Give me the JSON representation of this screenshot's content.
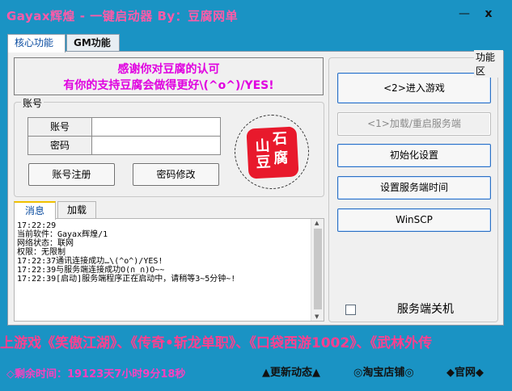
{
  "window": {
    "title": "Gayax辉煌 - 一键启动器  By：豆腐网单",
    "minimize_label": "—",
    "close_label": "x"
  },
  "top_tabs": [
    {
      "label": "核心功能"
    },
    {
      "label": "GM功能"
    }
  ],
  "banner": {
    "line1": "感谢你对豆腐的认可",
    "line2": "有你的支持豆腐会做得更好\\(^o^)/YES!"
  },
  "account": {
    "group_label": "账号",
    "username_label": "账号",
    "password_label": "密码",
    "username_value": "",
    "password_value": "",
    "register_button": "账号注册",
    "change_password_button": "密码修改",
    "seal_chars": [
      "山",
      "石",
      "豆",
      "腐"
    ]
  },
  "log_tabs": [
    {
      "label": "消息"
    },
    {
      "label": "加载"
    }
  ],
  "log": {
    "text": "17:22:29\n当前软件：Gayax辉煌/1\n网络状态：联网\n权限：无限制\n17:22:37通讯连接成功…\\(^o^)/YES!\n17:22:39与服务端连接成功O(∩_∩)O~~\n17:22:39[启动]服务端程序正在启动中，请稍等3~5分钟~!"
  },
  "functions": {
    "group_label": "功能区",
    "enter_game_button": "<2>进入游戏",
    "load_restart_button": "<1>加载/重启服务端",
    "init_button": "初始化设置",
    "set_time_button": "设置服务端时间",
    "winscp_button": "WinSCP",
    "shutdown_label": "服务端关机",
    "shutdown_checked": false
  },
  "marquee": {
    "text": "上游戏《笑傲江湖》、《传奇•斩龙单职》、《口袋西游1002》、《武林外传"
  },
  "footer": {
    "remaining_time": "◇剩余时间：19123天7小时9分18秒",
    "update_link": "▲更新动态▲",
    "taobao_link": "◎淘宝店铺◎",
    "official_link": "◆官网◆"
  },
  "colors": {
    "background": "#1a93c4",
    "title": "#ff5aa8",
    "banner_text": "#e000e0",
    "marquee": "#ff3f8f",
    "seal": "#e8192c"
  }
}
